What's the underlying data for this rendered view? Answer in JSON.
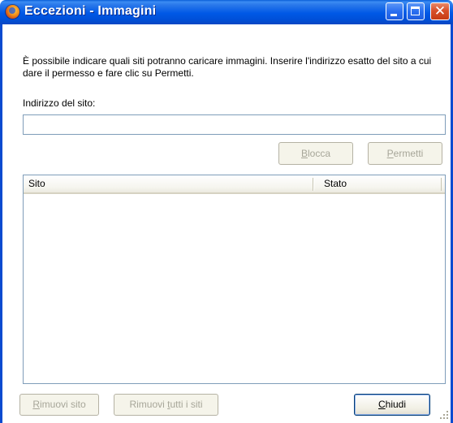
{
  "window": {
    "title": "Eccezioni - Immagini",
    "icon": "firefox-icon"
  },
  "description": "È possibile indicare quali siti potranno caricare immagini. Inserire l'indirizzo esatto del sito a cui dare il permesso e fare clic su Permetti.",
  "address": {
    "label": "Indirizzo del sito:",
    "value": ""
  },
  "actions": {
    "block_pre": "",
    "block_key": "B",
    "block_post": "locca",
    "allow_pre": "",
    "allow_key": "P",
    "allow_post": "ermetti"
  },
  "list": {
    "columns": [
      "Sito",
      "Stato"
    ],
    "rows": []
  },
  "footer": {
    "remove_pre": "",
    "remove_key": "R",
    "remove_post": "imuovi sito",
    "remove_all_pre": "Rimuovi ",
    "remove_all_key": "t",
    "remove_all_post": "utti i siti",
    "close_pre": "",
    "close_key": "C",
    "close_post": "hiudi"
  },
  "colors": {
    "titlebar": "#0058e6",
    "close_button": "#d8502a",
    "disabled_text": "#a7a699"
  }
}
